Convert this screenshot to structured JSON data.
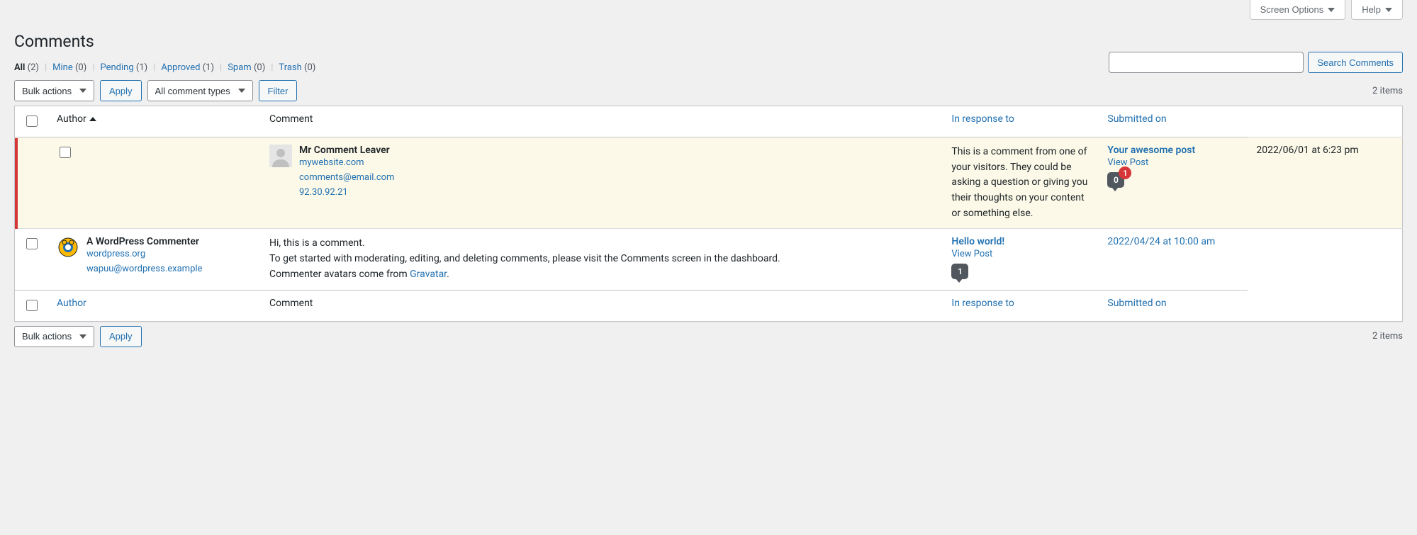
{
  "top_tabs": {
    "screen_options": "Screen Options",
    "help": "Help"
  },
  "page_title": "Comments",
  "filters": {
    "all": {
      "label": "All",
      "count": "(2)"
    },
    "mine": {
      "label": "Mine",
      "count": "(0)"
    },
    "pending": {
      "label": "Pending",
      "count": "(1)"
    },
    "approved": {
      "label": "Approved",
      "count": "(1)"
    },
    "spam": {
      "label": "Spam",
      "count": "(0)"
    },
    "trash": {
      "label": "Trash",
      "count": "(0)"
    }
  },
  "search": {
    "button": "Search Comments",
    "value": ""
  },
  "bulk": {
    "select_label": "Bulk actions",
    "apply": "Apply",
    "comment_types": "All comment types",
    "filter": "Filter"
  },
  "pagination": {
    "items_text": "2 items"
  },
  "columns": {
    "author": "Author",
    "comment": "Comment",
    "response": "In response to",
    "date": "Submitted on"
  },
  "comments": [
    {
      "status": "unapproved",
      "author": "Mr Comment Leaver",
      "website": "mywebsite.com",
      "email": "comments@email.com",
      "ip": "92.30.92.21",
      "avatar_type": "default",
      "text": "This is a comment from one of your visitors. They could be asking a question or giving you their thoughts on your content or something else.",
      "post_title": "Your awesome post",
      "view_post": "View Post",
      "approved_count": "0",
      "pending_count": "1",
      "date": "2022/06/01 at 6:23 pm"
    },
    {
      "status": "approved",
      "author": "A WordPress Commenter",
      "website": "wordpress.org",
      "email": "wapuu@wordpress.example",
      "ip": "",
      "avatar_type": "wapuu",
      "text_pre": "Hi, this is a comment.\nTo get started with moderating, editing, and deleting comments, please visit the Comments screen in the dashboard.\nCommenter avatars come from ",
      "text_link": "Gravatar",
      "text_post": ".",
      "post_title": "Hello world!",
      "view_post": "View Post",
      "approved_count": "1",
      "pending_count": "",
      "date": "2022/04/24 at 10:00 am"
    }
  ]
}
